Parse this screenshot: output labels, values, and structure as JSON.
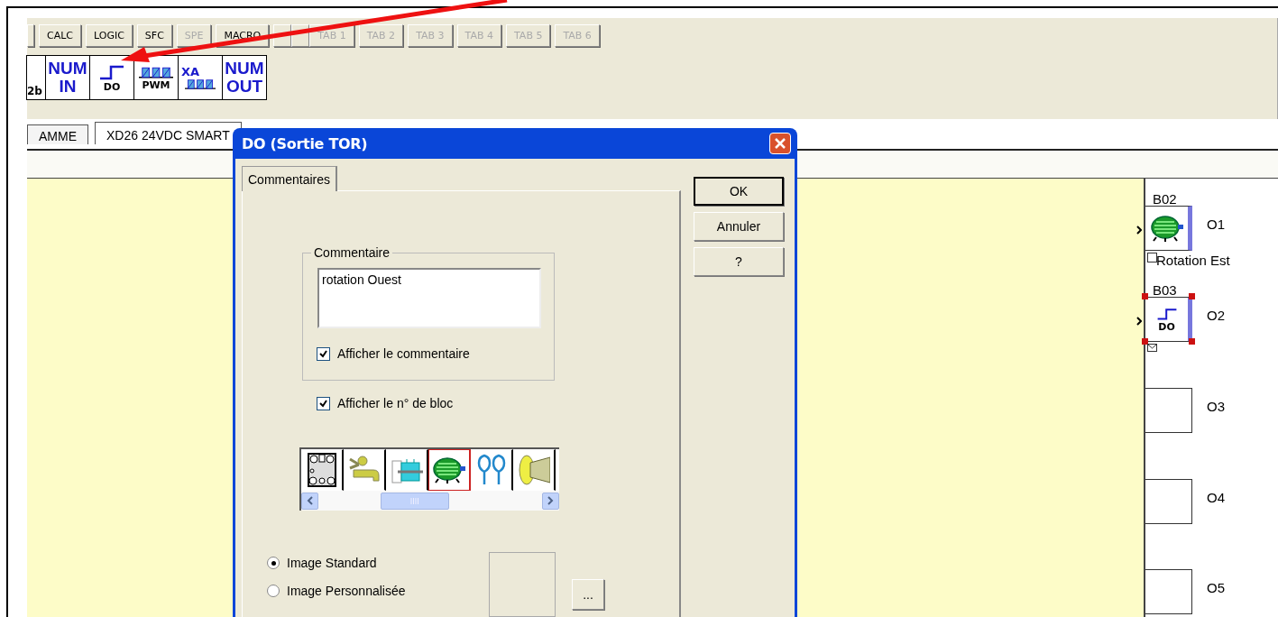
{
  "tool_tabs": [
    {
      "kind": "cut"
    },
    {
      "kind": "text",
      "label": "CALC",
      "disabled": false
    },
    {
      "kind": "text",
      "label": "LOGIC",
      "disabled": false
    },
    {
      "kind": "text",
      "label": "SFC",
      "disabled": false
    },
    {
      "kind": "text",
      "label": "SPE",
      "disabled": true
    },
    {
      "kind": "text",
      "label": "MACRO",
      "disabled": false
    },
    {
      "kind": "empty"
    },
    {
      "kind": "empty"
    },
    {
      "kind": "text",
      "label": "TAB 1",
      "disabled": true
    },
    {
      "kind": "text",
      "label": "TAB 2",
      "disabled": true
    },
    {
      "kind": "text",
      "label": "TAB 3",
      "disabled": true
    },
    {
      "kind": "text",
      "label": "TAB 4",
      "disabled": true
    },
    {
      "kind": "text",
      "label": "TAB 5",
      "disabled": true
    },
    {
      "kind": "text",
      "label": "TAB 6",
      "disabled": true
    }
  ],
  "palette": [
    {
      "kind": "cut",
      "label": "2b"
    },
    {
      "kind": "num",
      "lines": [
        "NUM",
        "IN"
      ]
    },
    {
      "kind": "step",
      "label": "DO"
    },
    {
      "kind": "pwm",
      "label": "PWM"
    },
    {
      "kind": "ramp",
      "label": "XA"
    },
    {
      "kind": "num",
      "lines": [
        "NUM",
        "OUT"
      ]
    }
  ],
  "document_tabs": [
    {
      "label": "AMME",
      "selected": false
    },
    {
      "label": "XD26 24VDC SMART",
      "selected": true
    }
  ],
  "outputs": [
    {
      "label": "O1",
      "block": "B02",
      "kind": "motor",
      "comment": "Rotation Est",
      "selected": false
    },
    {
      "label": "O2",
      "block": "B03",
      "kind": "step",
      "caption": "DO",
      "selected": true
    },
    {
      "label": "O3",
      "kind": "empty",
      "selected": false
    },
    {
      "label": "O4",
      "kind": "empty",
      "selected": false
    },
    {
      "label": "O5",
      "kind": "empty",
      "selected": false
    }
  ],
  "dialog": {
    "title": "DO (Sortie TOR)",
    "tabs": [
      {
        "label": "Commentaires",
        "selected": true
      }
    ],
    "group_label": "Commentaire",
    "comment": "rotation Ouest",
    "checkboxes": [
      {
        "label": "Afficher le commentaire",
        "checked": true
      },
      {
        "label": "Afficher le n° de bloc",
        "checked": true
      }
    ],
    "images": [
      {
        "kind": "terminal",
        "selected": false
      },
      {
        "kind": "tap",
        "selected": false
      },
      {
        "kind": "cylinder",
        "selected": false
      },
      {
        "kind": "motor",
        "selected": true
      },
      {
        "kind": "coil",
        "selected": false
      },
      {
        "kind": "horn",
        "selected": false
      }
    ],
    "radios": [
      {
        "label": "Image Standard",
        "selected": true
      },
      {
        "label": "Image Personnalisée",
        "selected": false
      }
    ],
    "browse_button": "...",
    "buttons": [
      {
        "label": "OK",
        "default": true
      },
      {
        "label": "Annuler",
        "default": false
      },
      {
        "label": "?",
        "default": false
      }
    ]
  }
}
